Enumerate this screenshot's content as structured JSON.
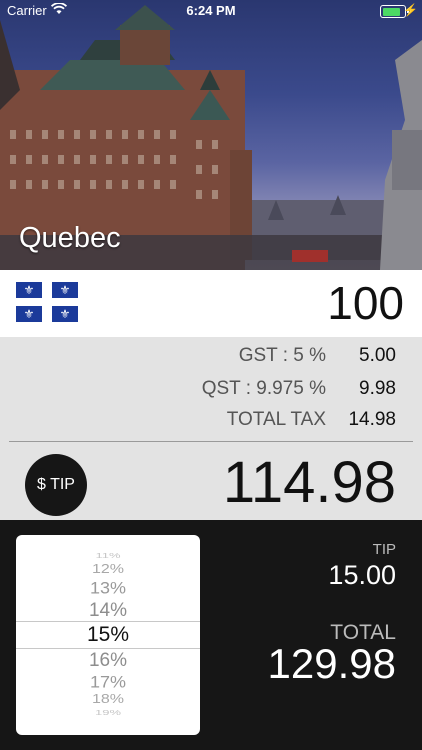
{
  "status_bar": {
    "carrier": "Carrier",
    "time": "6:24 PM"
  },
  "header": {
    "city": "Quebec"
  },
  "bill": {
    "amount": "100"
  },
  "taxes": [
    {
      "label": "GST : 5 %",
      "value": "5.00"
    },
    {
      "label": "QST : 9.975 %",
      "value": "9.98"
    },
    {
      "label": "TOTAL TAX",
      "value": "14.98"
    }
  ],
  "tip_button": {
    "label": "$ TIP"
  },
  "subtotal_with_tax": "114.98",
  "tip_picker": {
    "options": [
      "11%",
      "12%",
      "13%",
      "14%",
      "15%",
      "16%",
      "17%",
      "18%",
      "19%"
    ],
    "selected": "15%"
  },
  "summary": {
    "tip_label": "TIP",
    "tip_value": "15.00",
    "total_label": "TOTAL",
    "total_value": "129.98"
  },
  "colors": {
    "flag_blue": "#1b3a9a",
    "panel_gray": "#e3e3e3",
    "dark_bg": "#161616",
    "battery_green": "#4cd964"
  }
}
